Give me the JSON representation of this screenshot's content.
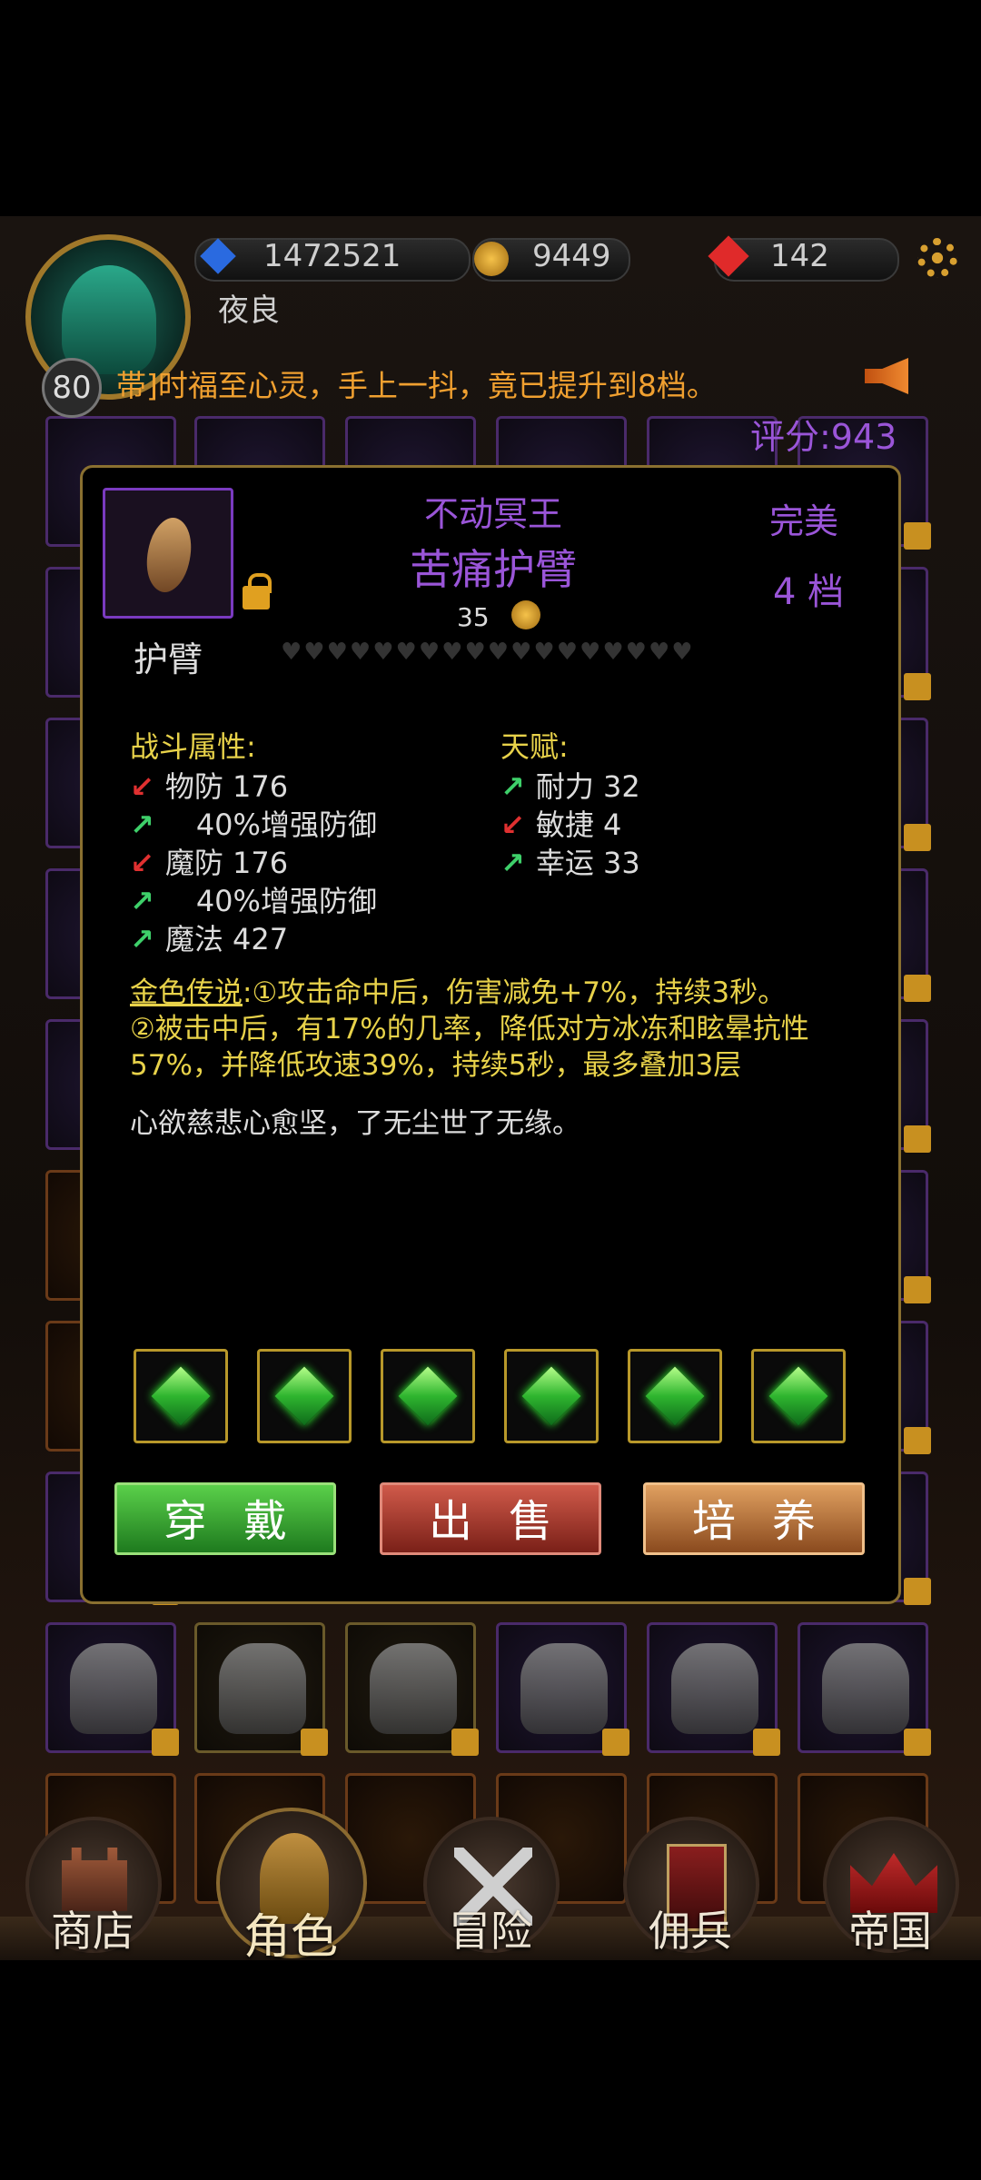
{
  "player": {
    "level": "80",
    "name": "夜良",
    "blue_currency": "1472521",
    "gold": "9449",
    "ruby": "142"
  },
  "announcement": "帯]时福至心灵，手上一抖，竟已提升到8档。",
  "score_label": "评分:943",
  "item": {
    "set_name": "不动冥王",
    "name": "苦痛护臂",
    "quality": "完美",
    "tier": "4 档",
    "price": "35",
    "type": "护臂",
    "hearts": 18,
    "combat_header": "战斗属性:",
    "talent_header": "天赋:",
    "combat_stats": [
      {
        "dir": "down",
        "text": "物防 176"
      },
      {
        "dir": "up",
        "text": "40%增强防御",
        "indent": true
      },
      {
        "dir": "down",
        "text": "魔防 176"
      },
      {
        "dir": "up",
        "text": "40%增强防御",
        "indent": true
      },
      {
        "dir": "up",
        "text": "魔法 427"
      }
    ],
    "talents": [
      {
        "dir": "up",
        "text": "耐力 32"
      },
      {
        "dir": "down",
        "text": "敏捷 4"
      },
      {
        "dir": "up",
        "text": "幸运 33"
      }
    ],
    "legend_label": "金色传说",
    "legend_line1": ":①攻击命中后，伤害减免+7%，持续3秒。",
    "legend_line2": "②被击中后，有17%的几率，降低对方冰冻和眩晕抗性",
    "legend_line3": "57%，并降低攻速39%，持续5秒，最多叠加3层",
    "flavor": "心欲慈悲心愈坚，了无尘世了无缘。",
    "gem_count": 6
  },
  "buttons": {
    "equip": "穿戴",
    "sell": "出售",
    "train": "培养"
  },
  "nav": [
    "商店",
    "角色",
    "冒险",
    "佣兵",
    "帝国"
  ],
  "colors": {
    "purple": "#9a55d8",
    "gold_text": "#e8d24a",
    "announce": "#f0a030"
  },
  "icons": {
    "settings": "gear-icon",
    "lock": "lock-icon",
    "coin": "coin-icon",
    "megaphone": "megaphone-icon"
  }
}
